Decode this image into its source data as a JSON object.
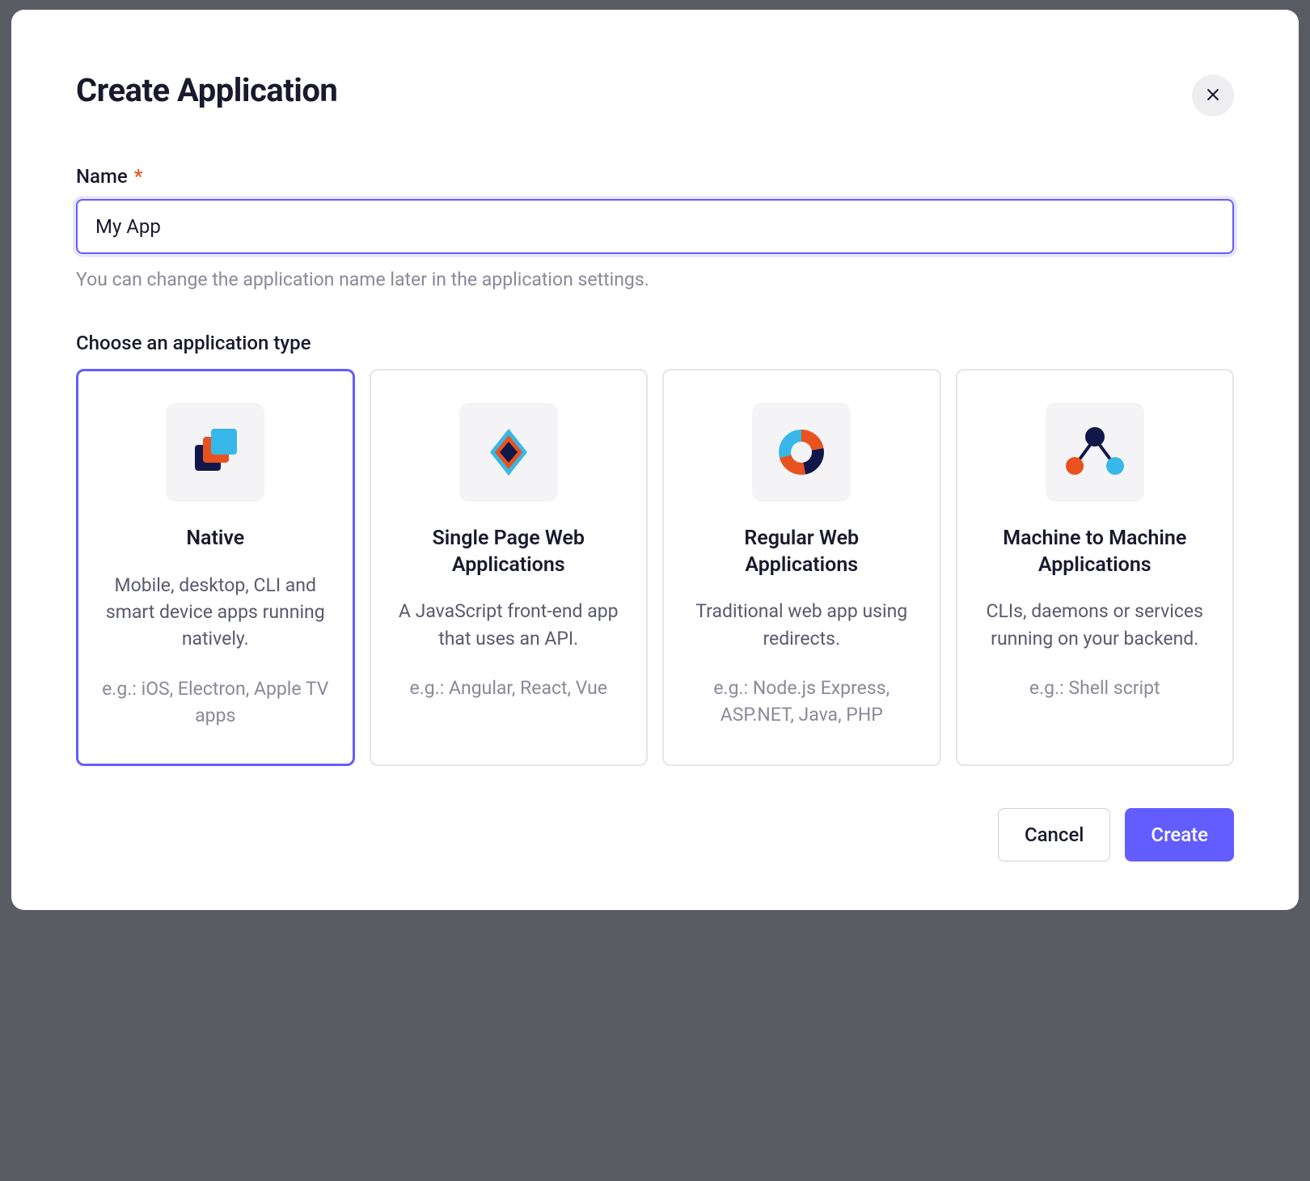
{
  "modal": {
    "title": "Create Application"
  },
  "name_field": {
    "label": "Name",
    "required_mark": "*",
    "value": "My App",
    "help": "You can change the application name later in the application settings."
  },
  "type_section": {
    "label": "Choose an application type"
  },
  "app_types": [
    {
      "title": "Native",
      "desc": "Mobile, desktop, CLI and smart device apps running natively.",
      "example": "e.g.: iOS, Electron, Apple TV apps",
      "selected": true,
      "icon": "native"
    },
    {
      "title": "Single Page Web Applications",
      "desc": "A JavaScript front-end app that uses an API.",
      "example": "e.g.: Angular, React, Vue",
      "selected": false,
      "icon": "spa"
    },
    {
      "title": "Regular Web Applications",
      "desc": "Traditional web app using redirects.",
      "example": "e.g.: Node.js Express, ASP.NET, Java, PHP",
      "selected": false,
      "icon": "regular"
    },
    {
      "title": "Machine to Machine Applications",
      "desc": "CLIs, daemons or services running on your backend.",
      "example": "e.g.: Shell script",
      "selected": false,
      "icon": "m2m"
    }
  ],
  "footer": {
    "cancel": "Cancel",
    "create": "Create"
  }
}
